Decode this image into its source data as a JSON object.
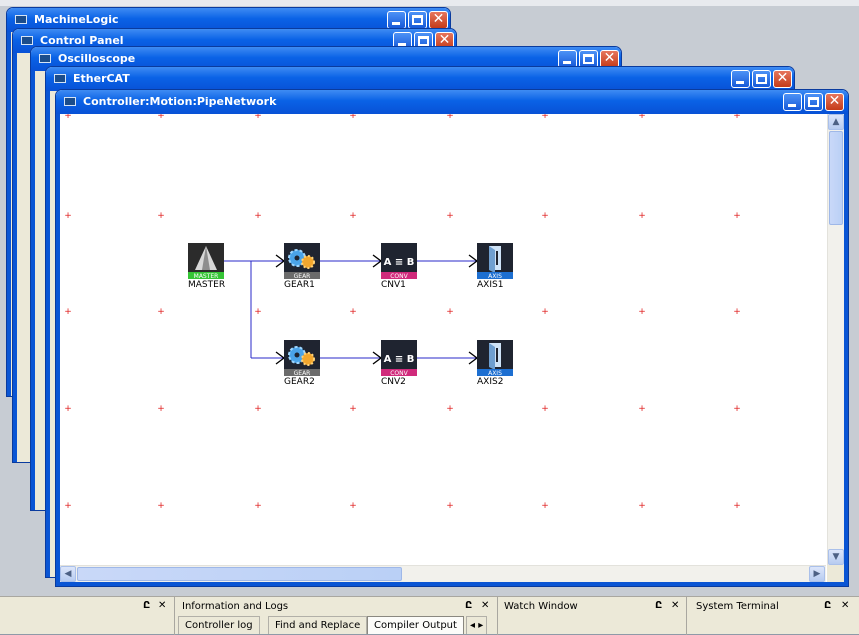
{
  "background_windows": [
    {
      "title": "MachineLogic"
    },
    {
      "title": "Control Panel"
    },
    {
      "title": "Oscilloscope"
    },
    {
      "title": "EtherCAT"
    }
  ],
  "main_window": {
    "title": "Controller:Motion:PipeNetwork",
    "nodes": [
      {
        "label": "MASTER",
        "badge": "MASTER",
        "badge_color": "#35c435",
        "kind": "master"
      },
      {
        "label": "GEAR1",
        "badge": "GEAR",
        "badge_color": "#6b6b6b",
        "kind": "gear"
      },
      {
        "label": "CNV1",
        "badge": "CONV",
        "badge_color": "#d02a7b",
        "kind": "conv"
      },
      {
        "label": "AXIS1",
        "badge": "AXIS",
        "badge_color": "#1d6fd1",
        "kind": "axis"
      },
      {
        "label": "GEAR2",
        "badge": "GEAR",
        "badge_color": "#6b6b6b",
        "kind": "gear"
      },
      {
        "label": "CNV2",
        "badge": "CONV",
        "badge_color": "#d02a7b",
        "kind": "conv"
      },
      {
        "label": "AXIS2",
        "badge": "AXIS",
        "badge_color": "#1d6fd1",
        "kind": "axis"
      }
    ],
    "conv_glyph": "A ≡ B"
  },
  "dock": {
    "info_title": "Information and Logs",
    "info_tabs": [
      "Controller log",
      "Find and Replace",
      "Compiler Output"
    ],
    "info_selected_tab": "Compiler Output",
    "watch_title": "Watch Window",
    "terminal_title": "System Terminal",
    "pin_glyph": "Ը",
    "close_glyph": "✕"
  },
  "colors": {
    "titlebar": "#0a62e6",
    "grid_marker": "#e02020",
    "link_line": "#2828c8"
  }
}
